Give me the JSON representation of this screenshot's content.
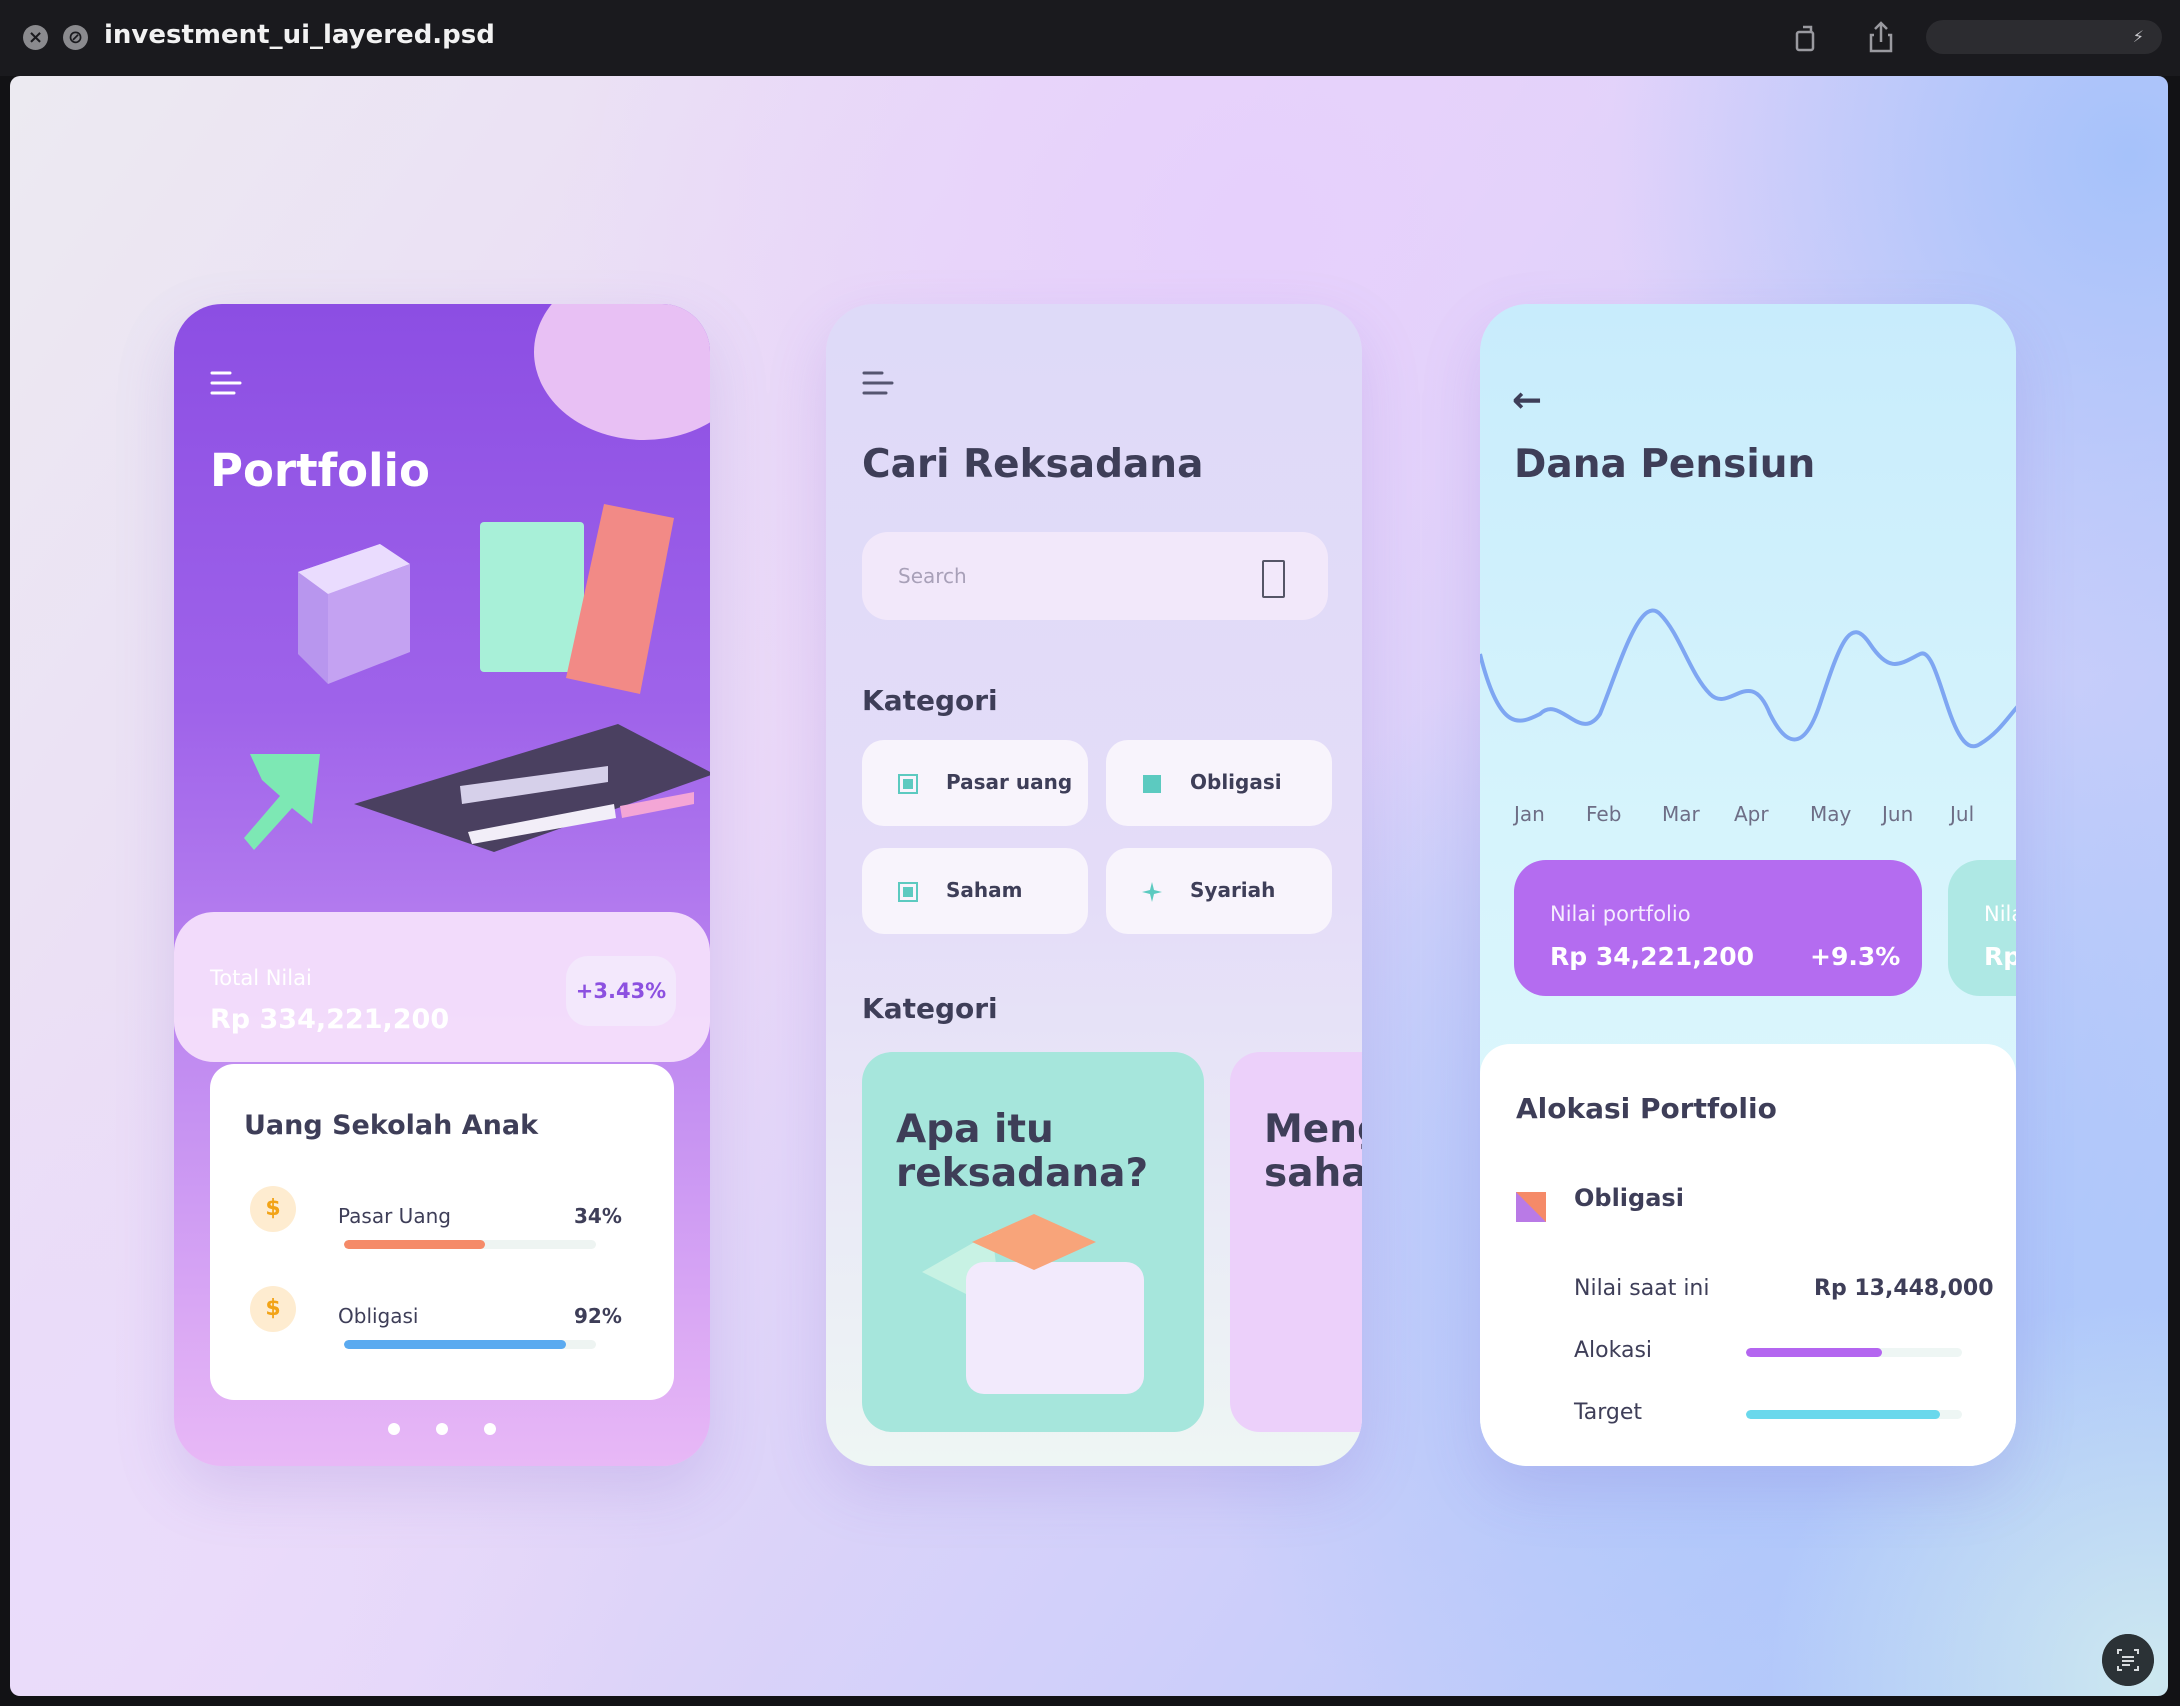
{
  "window": {
    "title": "investment_ui_layered.psd",
    "pill_text": "⚡"
  },
  "portfolio": {
    "title": "Portfolio",
    "total_label": "Total Nilai",
    "total_value": "Rp 334,221,200",
    "delta": "+3.43%",
    "goal": {
      "title": "Uang Sekolah Anak",
      "items": [
        {
          "name": "Pasar Uang",
          "pct": "34%",
          "progress": 0.56,
          "color": "#f58a68",
          "icon": "$"
        },
        {
          "name": "Obligasi",
          "pct": "92%",
          "progress": 0.88,
          "color": "#5aaaf0",
          "icon": "$"
        }
      ]
    },
    "page_indicator": {
      "count": 3
    }
  },
  "search_screen": {
    "title": "Cari Reksadana",
    "search_placeholder": "Search",
    "category_heading": "Kategori",
    "categories": [
      {
        "label": "Pasar uang",
        "icon": "square-outline-icon"
      },
      {
        "label": "Obligasi",
        "icon": "square-icon"
      },
      {
        "label": "Saham",
        "icon": "square-outline-icon"
      },
      {
        "label": "Syariah",
        "icon": "star-icon"
      }
    ],
    "article_heading": "Kategori",
    "articles": [
      {
        "title_line1": "Apa itu",
        "title_line2": "reksadana?"
      },
      {
        "title_line1": "Meng",
        "title_line2": "saha"
      }
    ]
  },
  "pension": {
    "back_icon": "←",
    "title": "Dana Pensiun",
    "months": [
      "Jan",
      "Feb",
      "Mar",
      "Apr",
      "May",
      "Jun",
      "Jul"
    ],
    "card_label": "Nilai portfolio",
    "card_value": "Rp 34,221,200",
    "card_pct": "+9.3%",
    "card2_label": "Nila",
    "card2_value": "Rp",
    "alloc_title": "Alokasi Portfolio",
    "alloc_asset": "Obligasi",
    "current_label": "Nilai saat ini",
    "current_value": "Rp 13,448,000",
    "allocation_label": "Alokasi",
    "allocation_level": 0.63,
    "target_label": "Target",
    "target_level": 0.9,
    "colors": {
      "allocation": "#b466f0",
      "target": "#6ad8ec"
    }
  }
}
